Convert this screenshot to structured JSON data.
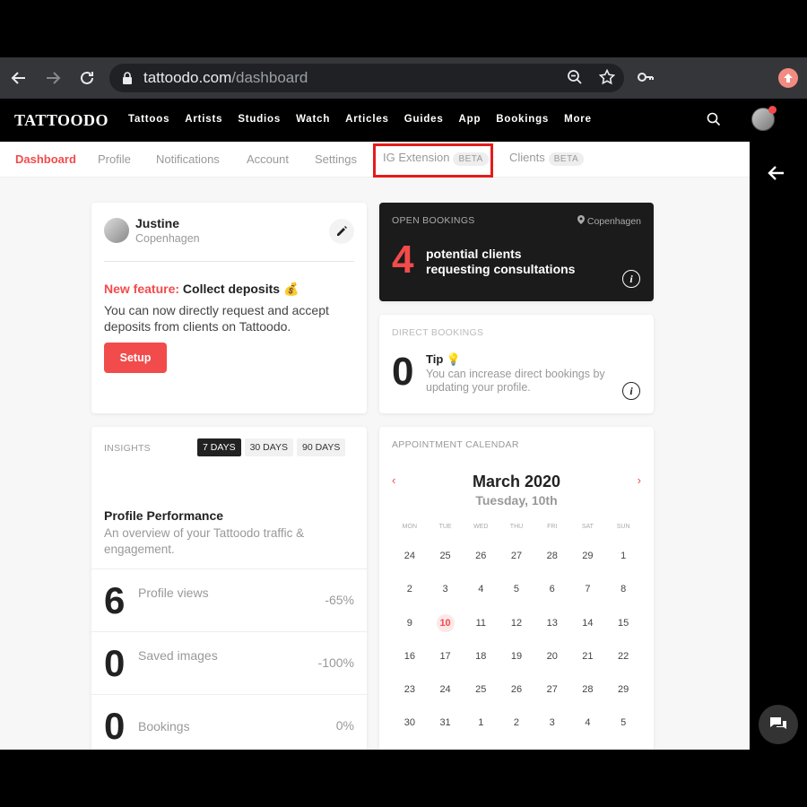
{
  "browser": {
    "url_host": "tattoodo.com",
    "url_path": "/dashboard"
  },
  "header": {
    "logo": "TATTOODO",
    "nav": [
      "Tattoos",
      "Artists",
      "Studios",
      "Watch",
      "Articles",
      "Guides",
      "App",
      "Bookings",
      "More"
    ]
  },
  "subnav": {
    "tabs": [
      {
        "label": "Dashboard"
      },
      {
        "label": "Profile"
      },
      {
        "label": "Notifications"
      },
      {
        "label": "Account"
      },
      {
        "label": "Settings"
      },
      {
        "label": "IG Extension",
        "badge": "BETA"
      },
      {
        "label": "Clients",
        "badge": "BETA"
      }
    ]
  },
  "profile": {
    "name": "Justine",
    "location": "Copenhagen",
    "feature_prefix": "New feature:",
    "feature_title": "Collect deposits 💰",
    "feature_desc": "You can now directly request and accept deposits from clients on Tattoodo.",
    "setup_label": "Setup"
  },
  "open_bookings": {
    "label": "OPEN BOOKINGS",
    "location": "Copenhagen",
    "count": "4",
    "message_line1": "potential clients",
    "message_line2": "requesting consultations"
  },
  "direct_bookings": {
    "label": "DIRECT BOOKINGS",
    "count": "0",
    "tip_title": "Tip 💡",
    "tip_desc": "You can increase direct bookings by updating your profile."
  },
  "insights": {
    "label": "INSIGHTS",
    "ranges": [
      "7 DAYS",
      "30 DAYS",
      "90 DAYS"
    ],
    "active_range": 0,
    "title": "Profile Performance",
    "desc": "An overview of your Tattoodo traffic & engagement.",
    "metrics": [
      {
        "value": "6",
        "label": "Profile views",
        "change": "-65%"
      },
      {
        "value": "0",
        "label": "Saved images",
        "change": "-100%"
      },
      {
        "value": "0",
        "label": "Bookings",
        "change": "0%"
      }
    ]
  },
  "calendar": {
    "label": "APPOINTMENT CALENDAR",
    "prev": "‹",
    "next": "›",
    "month": "March 2020",
    "day": "Tuesday, 10th",
    "weekdays": [
      "MON",
      "TUE",
      "WED",
      "THU",
      "FRI",
      "SAT",
      "SUN"
    ],
    "days": [
      "24",
      "25",
      "26",
      "27",
      "28",
      "29",
      "1",
      "2",
      "3",
      "4",
      "5",
      "6",
      "7",
      "8",
      "9",
      "10",
      "11",
      "12",
      "13",
      "14",
      "15",
      "16",
      "17",
      "18",
      "19",
      "20",
      "21",
      "22",
      "23",
      "24",
      "25",
      "26",
      "27",
      "28",
      "29",
      "30",
      "31",
      "1",
      "2",
      "3",
      "4",
      "5"
    ],
    "today_index": 15
  },
  "icons": {
    "back": "arrow-left-icon",
    "forward": "arrow-right-icon",
    "reload": "reload-icon",
    "lock": "lock-icon",
    "zoom": "zoom-icon",
    "star": "star-icon",
    "key": "key-icon",
    "search": "search-icon",
    "edit": "pencil-icon",
    "pin": "pin-icon",
    "info": "info-icon",
    "chat": "chat-icon"
  },
  "colors": {
    "accent": "#f24b4b",
    "highlight": "#e51b1b"
  }
}
